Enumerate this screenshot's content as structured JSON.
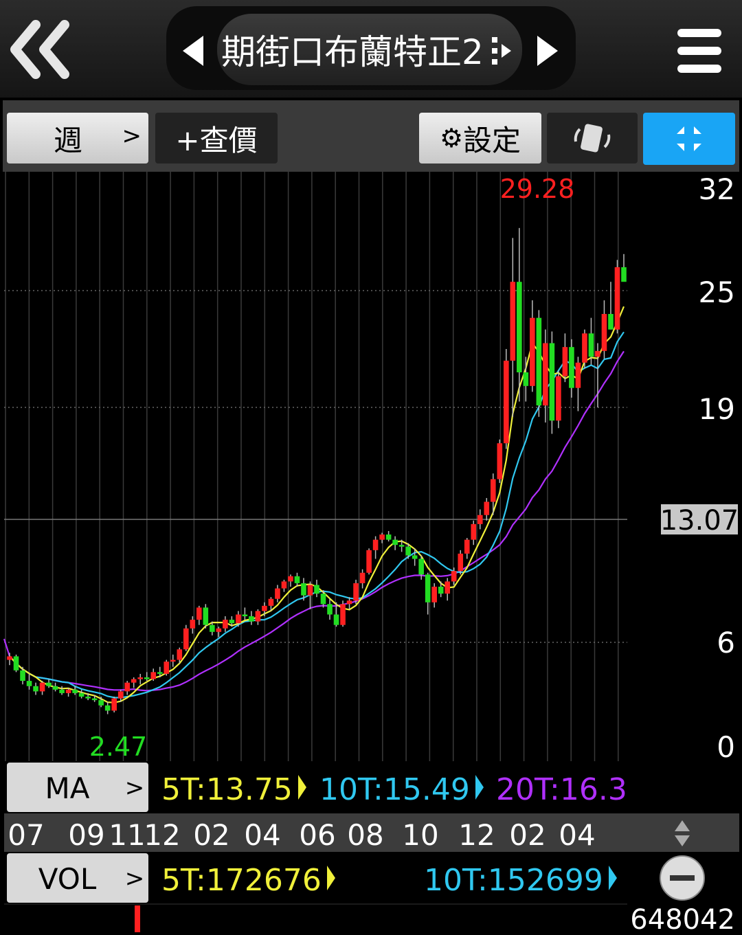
{
  "header": {
    "title": "期街口布蘭特正2",
    "back_icon": "double-chevron-left-icon",
    "prev_icon": "triangle-left-icon",
    "next_icon": "triangle-right-icon",
    "menu_icon": "hamburger-menu-icon"
  },
  "toolbar": {
    "period_label": "週",
    "quote_label": "+查價",
    "settings_label": "設定",
    "settings_icon": "gear-icon",
    "rotate_icon": "rotate-screen-icon",
    "fullscreen_icon": "collapse-arrows-icon"
  },
  "ma_row": {
    "button_label": "MA",
    "ma5": "5T:13.75",
    "ma10": "10T:15.49",
    "ma20": "20T:16.3"
  },
  "vol_row": {
    "button_label": "VOL",
    "vol5": "5T:172676",
    "vol10": "10T:152699",
    "max_label": "648042"
  },
  "colors": {
    "up": "#ff2020",
    "down": "#22dd22",
    "ma5": "#f0f03a",
    "ma10": "#30c8f0",
    "ma20": "#b030ff",
    "accent_blue": "#19a5f5"
  },
  "chart_data": {
    "type": "candlestick",
    "y_ticks": [
      "32",
      "25",
      "19",
      "6",
      "0"
    ],
    "ylim": [
      0,
      32
    ],
    "x_tick_labels": [
      "07",
      "09",
      "11",
      "12",
      "02",
      "04",
      "06",
      "08",
      "10",
      "12",
      "02",
      "04"
    ],
    "current_price": "13.07",
    "max_label": "29.28",
    "min_label": "2.47",
    "grid": true,
    "candles": [
      [
        5.0,
        5.4,
        4.7,
        5.2
      ],
      [
        5.2,
        5.3,
        4.3,
        4.4
      ],
      [
        4.4,
        4.6,
        3.6,
        3.8
      ],
      [
        3.8,
        4.2,
        3.3,
        3.5
      ],
      [
        3.5,
        3.7,
        3.0,
        3.2
      ],
      [
        3.2,
        3.8,
        3.0,
        3.7
      ],
      [
        3.7,
        3.9,
        3.4,
        3.5
      ],
      [
        3.5,
        3.7,
        3.2,
        3.3
      ],
      [
        3.3,
        3.5,
        3.0,
        3.1
      ],
      [
        3.1,
        3.4,
        2.9,
        3.3
      ],
      [
        3.3,
        3.5,
        3.0,
        3.1
      ],
      [
        3.1,
        3.3,
        2.8,
        2.9
      ],
      [
        2.9,
        3.1,
        2.7,
        2.8
      ],
      [
        2.8,
        3.0,
        2.6,
        2.7
      ],
      [
        2.7,
        2.9,
        2.3,
        2.4
      ],
      [
        2.4,
        2.6,
        1.9,
        2.1
      ],
      [
        2.1,
        2.9,
        2.0,
        2.8
      ],
      [
        2.8,
        3.3,
        2.6,
        3.2
      ],
      [
        3.2,
        3.8,
        3.0,
        3.7
      ],
      [
        3.7,
        4.0,
        3.4,
        3.9
      ],
      [
        3.9,
        4.2,
        3.6,
        4.0
      ],
      [
        4.0,
        4.3,
        3.8,
        3.9
      ],
      [
        3.9,
        4.5,
        3.8,
        4.3
      ],
      [
        4.3,
        4.6,
        4.0,
        4.2
      ],
      [
        4.2,
        5.0,
        4.1,
        4.9
      ],
      [
        4.9,
        5.3,
        4.6,
        5.0
      ],
      [
        5.0,
        5.7,
        4.8,
        5.6
      ],
      [
        5.6,
        7.0,
        5.5,
        6.8
      ],
      [
        6.8,
        7.5,
        6.5,
        7.3
      ],
      [
        7.3,
        8.1,
        7.0,
        8.0
      ],
      [
        8.0,
        8.2,
        6.8,
        7.0
      ],
      [
        7.0,
        7.2,
        6.4,
        6.6
      ],
      [
        6.6,
        6.9,
        6.3,
        6.8
      ],
      [
        6.8,
        7.5,
        6.6,
        7.3
      ],
      [
        7.3,
        7.5,
        6.9,
        7.1
      ],
      [
        7.1,
        7.8,
        6.9,
        7.6
      ],
      [
        7.6,
        8.0,
        7.3,
        7.5
      ],
      [
        7.5,
        7.8,
        7.0,
        7.2
      ],
      [
        7.2,
        7.9,
        7.0,
        7.8
      ],
      [
        7.8,
        8.3,
        7.5,
        8.1
      ],
      [
        8.1,
        8.6,
        7.8,
        8.5
      ],
      [
        8.5,
        9.3,
        8.3,
        9.1
      ],
      [
        9.1,
        9.6,
        8.9,
        9.5
      ],
      [
        9.5,
        9.9,
        9.2,
        9.8
      ],
      [
        9.8,
        10.0,
        9.2,
        9.4
      ],
      [
        9.4,
        9.7,
        8.4,
        8.7
      ],
      [
        8.7,
        9.5,
        7.9,
        9.3
      ],
      [
        9.3,
        9.6,
        8.6,
        8.8
      ],
      [
        8.8,
        9.0,
        8.0,
        8.2
      ],
      [
        8.2,
        8.5,
        7.3,
        7.6
      ],
      [
        7.6,
        8.3,
        6.9,
        7.0
      ],
      [
        7.0,
        8.4,
        6.9,
        8.2
      ],
      [
        8.2,
        8.6,
        7.9,
        8.4
      ],
      [
        8.4,
        9.6,
        8.2,
        9.4
      ],
      [
        9.4,
        10.2,
        9.1,
        10.0
      ],
      [
        10.0,
        11.4,
        9.9,
        11.3
      ],
      [
        11.3,
        12.1,
        10.8,
        11.9
      ],
      [
        11.9,
        12.3,
        11.7,
        12.2
      ],
      [
        12.2,
        12.4,
        11.8,
        11.9
      ],
      [
        11.9,
        12.1,
        11.3,
        11.6
      ],
      [
        11.6,
        11.9,
        11.2,
        11.5
      ],
      [
        11.5,
        11.7,
        10.8,
        11.0
      ],
      [
        11.0,
        11.4,
        10.4,
        10.8
      ],
      [
        10.8,
        11.0,
        9.6,
        9.9
      ],
      [
        9.9,
        10.0,
        7.6,
        8.3
      ],
      [
        8.3,
        9.4,
        8.0,
        9.2
      ],
      [
        9.2,
        9.5,
        8.6,
        8.8
      ],
      [
        8.8,
        9.7,
        8.4,
        9.5
      ],
      [
        9.5,
        10.3,
        9.3,
        10.1
      ],
      [
        10.1,
        11.3,
        9.9,
        11.1
      ],
      [
        11.1,
        12.0,
        10.8,
        11.9
      ],
      [
        11.9,
        13.0,
        11.6,
        12.8
      ],
      [
        12.8,
        13.6,
        12.5,
        13.3
      ],
      [
        13.3,
        14.2,
        13.0,
        14.0
      ],
      [
        14.0,
        15.5,
        13.3,
        15.2
      ],
      [
        15.2,
        17.3,
        15.0,
        17.1
      ],
      [
        17.1,
        22.0,
        16.8,
        21.4
      ],
      [
        21.4,
        28.6,
        18.5,
        25.6
      ],
      [
        25.6,
        29.28,
        19.3,
        20.8
      ],
      [
        20.8,
        21.6,
        19.3,
        20.1
      ],
      [
        20.1,
        24.5,
        19.8,
        23.6
      ],
      [
        23.6,
        24.0,
        18.5,
        19.1
      ],
      [
        19.1,
        23.0,
        18.2,
        22.3
      ],
      [
        22.3,
        22.9,
        17.6,
        18.3
      ],
      [
        18.3,
        20.9,
        17.9,
        20.6
      ],
      [
        20.6,
        22.8,
        20.3,
        22.1
      ],
      [
        22.1,
        22.5,
        19.5,
        20.0
      ],
      [
        20.0,
        21.6,
        18.8,
        21.3
      ],
      [
        21.3,
        23.0,
        21.0,
        22.8
      ],
      [
        22.8,
        23.6,
        21.2,
        21.6
      ],
      [
        21.6,
        22.3,
        19.0,
        21.9
      ],
      [
        21.9,
        24.5,
        21.5,
        23.8
      ],
      [
        23.8,
        25.6,
        23.0,
        23.0
      ],
      [
        23.0,
        27.1,
        22.8,
        26.6
      ],
      [
        26.6,
        27.5,
        26.0,
        25.6
      ]
    ]
  }
}
